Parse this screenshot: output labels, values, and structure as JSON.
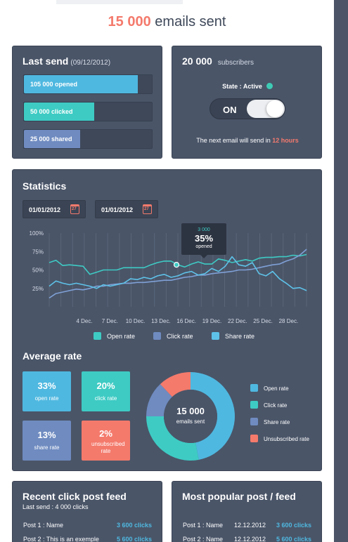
{
  "headline": {
    "number": "15 000",
    "text": "emails sent"
  },
  "last_send": {
    "title": "Last send",
    "date": "(09/12/2012)",
    "bars": [
      {
        "label": "105 000 opened",
        "fraction": 0.89,
        "color": "#4fb8e0"
      },
      {
        "label": "50 000 clicked",
        "fraction": 0.55,
        "color": "#3ecbc4"
      },
      {
        "label": "25 000 shared",
        "fraction": 0.44,
        "color": "#6f8bc0"
      }
    ]
  },
  "subscribers": {
    "count": "20 000",
    "label": "subscribers",
    "state_label": "State : Active",
    "toggle_label": "ON",
    "next_prefix": "The next email will send in",
    "next_value": "12 hours"
  },
  "statistics": {
    "title": "Statistics",
    "date_from": "01/01/2012",
    "date_to": "01/01/2012",
    "calendar_glyph": "27",
    "tooltip": {
      "value": "3 000",
      "percent": "35%",
      "label": "opened"
    }
  },
  "chart_data": {
    "type": "line",
    "y_ticks": [
      "100%",
      "75%",
      "50%",
      "25%"
    ],
    "ylim": [
      0,
      100
    ],
    "x_labels": [
      "4 Dec.",
      "7 Dec.",
      "10 Dec.",
      "13 Dec.",
      "16 Dec.",
      "19 Dec.",
      "22 Dec.",
      "25 Dec.",
      "28 Dec."
    ],
    "grid": true,
    "legend_position": "bottom",
    "series": [
      {
        "name": "Open rate",
        "color": "#3ecbc4",
        "values": [
          60,
          63,
          56,
          57,
          56,
          55,
          44,
          47,
          50,
          50,
          50,
          53,
          53,
          53,
          53,
          57,
          60,
          62,
          62,
          57,
          54,
          58,
          61,
          58,
          58,
          65,
          63,
          60,
          62,
          64,
          62,
          66,
          67,
          67,
          68,
          68,
          70,
          69,
          71
        ]
      },
      {
        "name": "Click rate",
        "color": "#7fa0d6",
        "values": [
          12,
          18,
          20,
          22,
          24,
          23,
          25,
          28,
          28,
          30,
          31,
          32,
          32,
          33,
          33,
          34,
          35,
          36,
          36,
          38,
          40,
          41,
          43,
          43,
          45,
          46,
          47,
          48,
          50,
          50,
          51,
          53,
          55,
          57,
          58,
          62,
          65,
          70,
          78
        ]
      },
      {
        "name": "Share rate",
        "color": "#5ec2e8",
        "values": [
          28,
          35,
          32,
          30,
          32,
          30,
          28,
          25,
          30,
          28,
          30,
          32,
          38,
          37,
          40,
          38,
          42,
          44,
          40,
          42,
          46,
          48,
          43,
          45,
          52,
          48,
          55,
          68,
          57,
          55,
          60,
          45,
          42,
          48,
          38,
          32,
          25,
          26,
          22
        ]
      }
    ]
  },
  "average_rate": {
    "title": "Average rate",
    "tiles": [
      {
        "value": "33%",
        "label": "open rate",
        "color": "#4fb8e0"
      },
      {
        "value": "20%",
        "label": "click rate",
        "color": "#3ecbc4"
      },
      {
        "value": "13%",
        "label": "share rate",
        "color": "#6f8bc0"
      },
      {
        "value": "2%",
        "label": "unsubscribed rate",
        "color": "#f47a6c"
      }
    ],
    "donut": {
      "center_value": "15 000",
      "center_label": "emails sent",
      "slices": [
        {
          "name": "Open rate",
          "fraction": 0.47,
          "color": "#4fb8e0"
        },
        {
          "name": "Click rate",
          "fraction": 0.28,
          "color": "#3ecbc4"
        },
        {
          "name": "Share rate",
          "fraction": 0.13,
          "color": "#6f8bc0"
        },
        {
          "name": "Unsubscribed rate",
          "fraction": 0.12,
          "color": "#f47a6c"
        }
      ]
    },
    "legend": [
      "Open rate",
      "Click rate",
      "Share rate",
      "Unsubscribed rate"
    ]
  },
  "recent_feed": {
    "title": "Recent click post feed",
    "subtitle": "Last send : 4 000 clicks",
    "rows": [
      {
        "label": "Post 1 : Name",
        "value": "3 600 clicks"
      },
      {
        "label": "Post 2 : This is an exemple",
        "value": "5 600 clicks"
      }
    ]
  },
  "popular_feed": {
    "title": "Most popular post / feed",
    "rows": [
      {
        "label": "Post 1 : Name",
        "date": "12.12.2012",
        "value": "3 600 clicks"
      },
      {
        "label": "Post 2 : Name",
        "date": "12.12.2012",
        "value": "5 600 clicks"
      }
    ]
  }
}
